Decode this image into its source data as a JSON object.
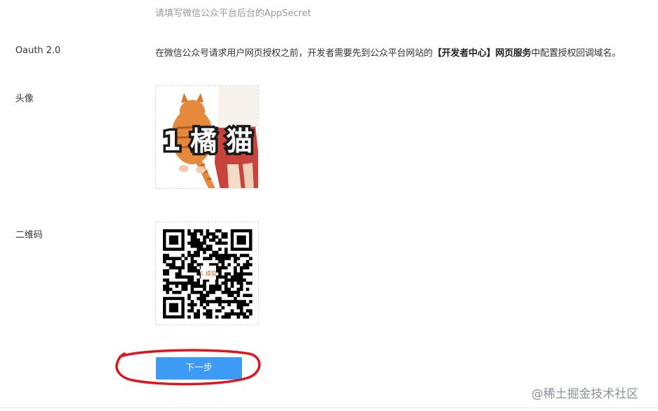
{
  "appsecret_hint": "请填写微信公众平台后台的AppSecret",
  "oauth": {
    "label": "Oauth 2.0",
    "desc_before": "在微信公众号请求用户网页授权之前，开发者需要先到公众平台网站的",
    "desc_bold1": "【开发者中心】",
    "desc_bold2": "网页服务",
    "desc_after": "中配置授权回调域名。"
  },
  "avatar": {
    "label": "头像",
    "image_text": "1 橘 猫"
  },
  "qrcode": {
    "label": "二维码",
    "center_text": "1 橘猫"
  },
  "next_button": {
    "label": "下一步"
  },
  "watermark": "@稀土掘金技术社区",
  "colors": {
    "button": "#3d9af5",
    "annotation": "#e0141e",
    "hint": "#999999"
  }
}
